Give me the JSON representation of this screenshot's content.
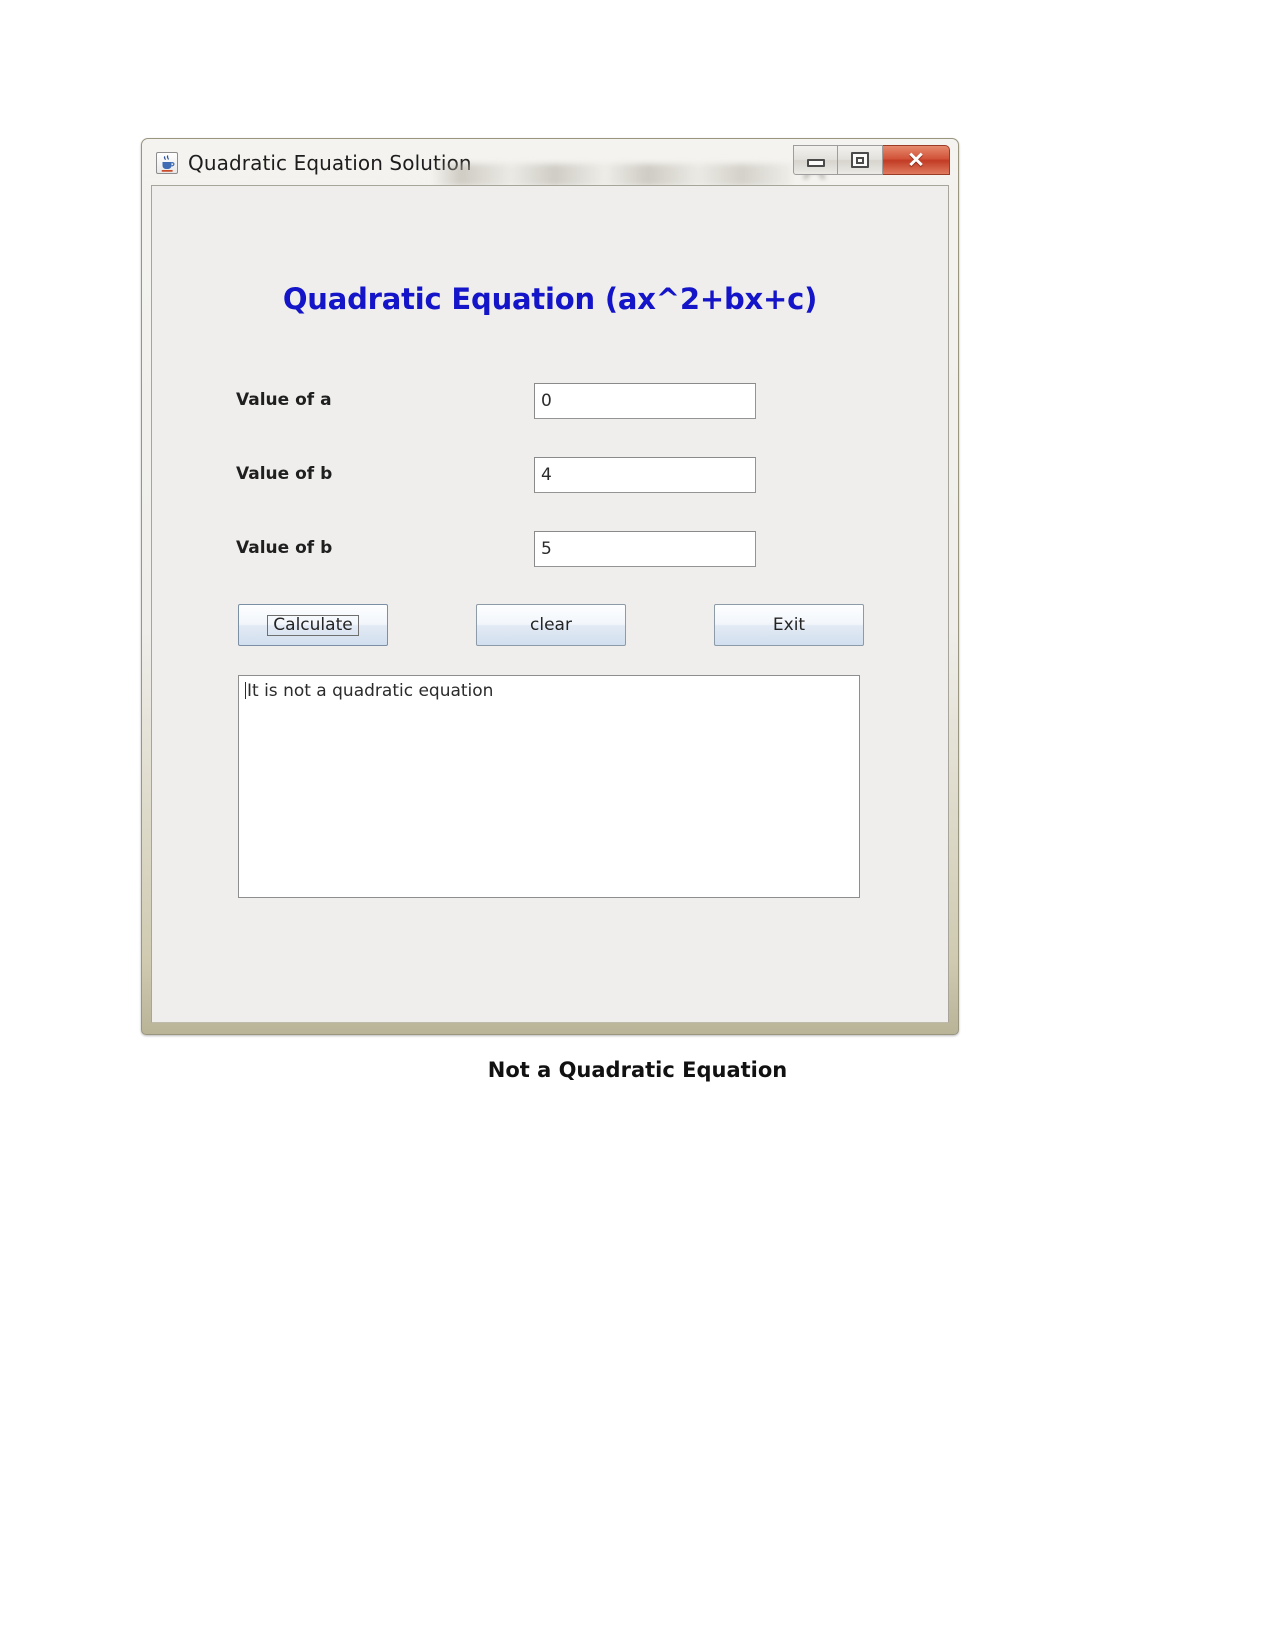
{
  "window": {
    "title": "Quadratic Equation Solution",
    "app_icon": "java-coffee-cup-icon",
    "controls": {
      "minimize_label": "–",
      "maximize_label": "□",
      "close_label": "✕"
    }
  },
  "heading": "Quadratic Equation (ax^2+bx+c)",
  "form": {
    "fields": [
      {
        "label": "Value of a",
        "value": "0",
        "name": "value-of-a"
      },
      {
        "label": "Value of b",
        "value": "4",
        "name": "value-of-b"
      },
      {
        "label": "Value of b",
        "value": "5",
        "name": "value-of-b-2"
      }
    ]
  },
  "buttons": {
    "calculate": "Calculate",
    "clear": "clear",
    "exit": "Exit"
  },
  "output": {
    "text": "It is not a quadratic equation"
  },
  "caption": "Not a Quadratic Equation",
  "colors": {
    "heading": "#1414c8",
    "close_button": "#c23b24",
    "window_frame": "#b9b398",
    "client_background": "#efeeec"
  }
}
